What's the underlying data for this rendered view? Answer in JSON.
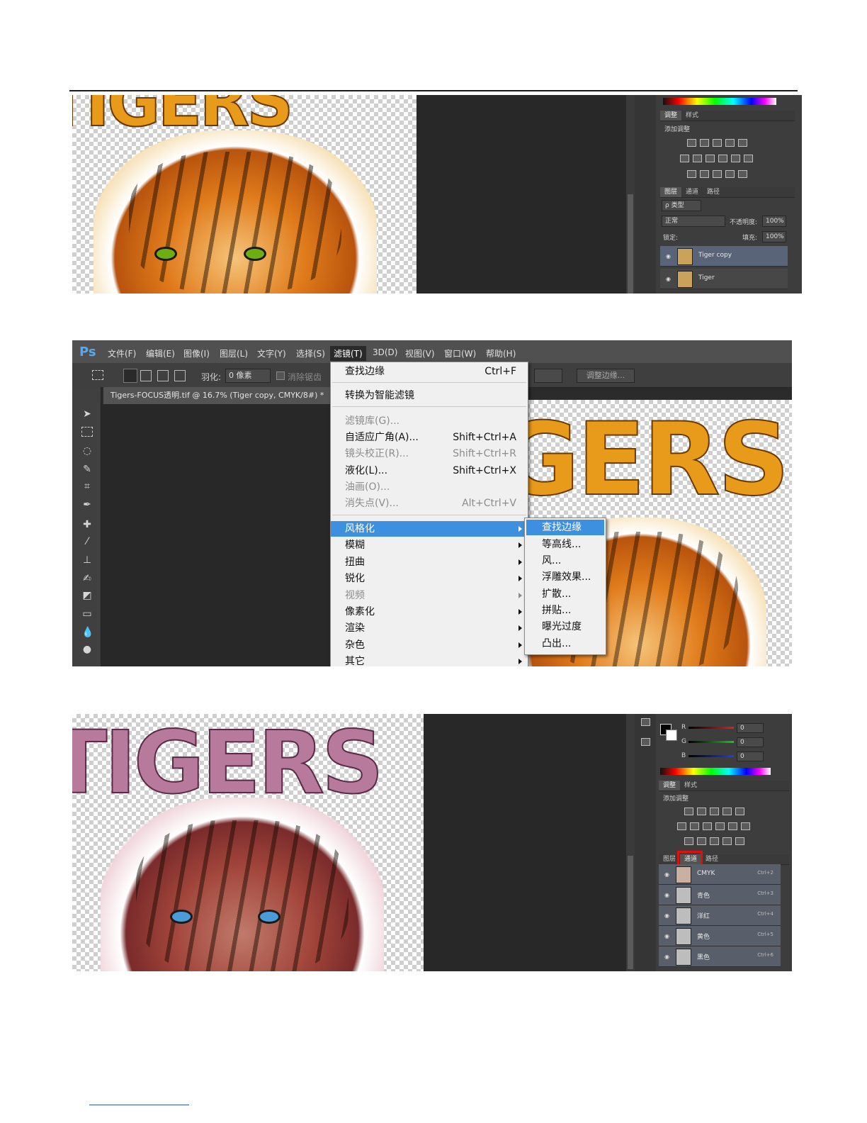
{
  "screenshot1": {
    "art_text": "TIGERS",
    "panel": {
      "tabs_top": [
        "调整",
        "样式"
      ],
      "adjust_title": "添加调整",
      "tabs_layers": [
        "图层",
        "通道",
        "路径"
      ],
      "kind_label": "ρ 类型",
      "blend_mode": "正常",
      "opacity_label": "不透明度:",
      "opacity_value": "100%",
      "lock_label": "锁定:",
      "fill_label": "填充:",
      "fill_value": "100%",
      "layers": [
        "Tiger copy",
        "Tiger"
      ]
    }
  },
  "screenshot2": {
    "ps_logo": "Ps",
    "menu_items": [
      "文件(F)",
      "编辑(E)",
      "图像(I)",
      "图层(L)",
      "文字(Y)",
      "选择(S)",
      "滤镜(T)",
      "3D(D)",
      "视图(V)",
      "窗口(W)",
      "帮助(H)"
    ],
    "feather_label": "羽化:",
    "feather_value": "0 像素",
    "antialias_label": "消除锯齿",
    "refine_edge_button": "调整边缘...",
    "doc_tab": "Tigers-FOCUS透明.tif @ 16.7% (Tiger copy, CMYK/8#) *",
    "art_text": "GERS",
    "filter_menu": {
      "last_filter": "查找边缘",
      "last_filter_shortcut": "Ctrl+F",
      "smart_filter": "转换为智能滤镜",
      "items": [
        {
          "label": "滤镜库(G)...",
          "shortcut": "",
          "disabled": true
        },
        {
          "label": "自适应广角(A)...",
          "shortcut": "Shift+Ctrl+A",
          "disabled": false
        },
        {
          "label": "镜头校正(R)...",
          "shortcut": "Shift+Ctrl+R",
          "disabled": true
        },
        {
          "label": "液化(L)...",
          "shortcut": "Shift+Ctrl+X",
          "disabled": false
        },
        {
          "label": "油画(O)...",
          "shortcut": "",
          "disabled": true
        },
        {
          "label": "消失点(V)...",
          "shortcut": "Alt+Ctrl+V",
          "disabled": true
        }
      ],
      "submenus": [
        {
          "label": "风格化",
          "disabled": false,
          "highlighted": true
        },
        {
          "label": "模糊",
          "disabled": false
        },
        {
          "label": "扭曲",
          "disabled": false
        },
        {
          "label": "锐化",
          "disabled": false
        },
        {
          "label": "视频",
          "disabled": true
        },
        {
          "label": "像素化",
          "disabled": false
        },
        {
          "label": "渲染",
          "disabled": false
        },
        {
          "label": "杂色",
          "disabled": false
        },
        {
          "label": "其它",
          "disabled": false
        }
      ]
    },
    "stylize_submenu": [
      "查找边缘",
      "等高线...",
      "风...",
      "浮雕效果...",
      "扩散...",
      "拼贴...",
      "曝光过度",
      "凸出..."
    ]
  },
  "screenshot3": {
    "art_text": "TIGERS",
    "color_panel": {
      "channels": [
        {
          "label": "R",
          "value": "0",
          "color": "#e02020"
        },
        {
          "label": "G",
          "value": "0",
          "color": "#20c020"
        },
        {
          "label": "B",
          "value": "0",
          "color": "#2040e0"
        }
      ]
    },
    "tabs_top": [
      "调整",
      "样式"
    ],
    "adjust_title": "添加调整",
    "tabs_layers": [
      "图层",
      "通道",
      "路径"
    ],
    "channels": [
      {
        "name": "CMYK",
        "shortcut": "Ctrl+2"
      },
      {
        "name": "青色",
        "shortcut": "Ctrl+3"
      },
      {
        "name": "洋红",
        "shortcut": "Ctrl+4"
      },
      {
        "name": "黄色",
        "shortcut": "Ctrl+5"
      },
      {
        "name": "黑色",
        "shortcut": "Ctrl+6"
      }
    ],
    "highlight_color": "#e01010"
  }
}
